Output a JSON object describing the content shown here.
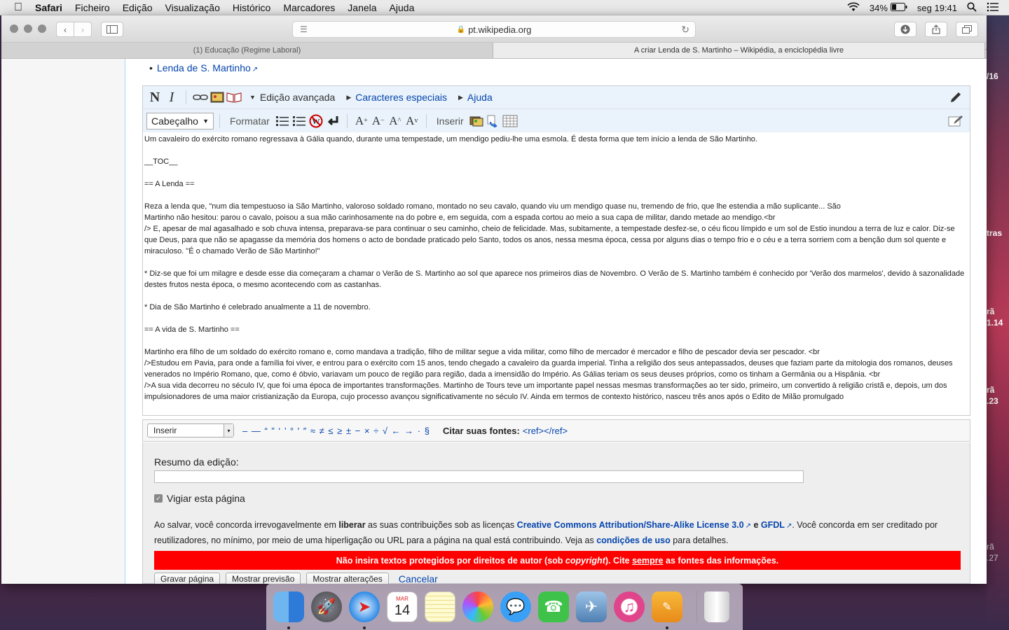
{
  "menubar": {
    "app": "Safari",
    "items": [
      "Ficheiro",
      "Edição",
      "Visualização",
      "Histórico",
      "Marcadores",
      "Janela",
      "Ajuda"
    ],
    "battery": "34%",
    "clock": "seg 19:41"
  },
  "browser": {
    "url": "pt.wikipedia.org",
    "tabs": [
      "(1) Educação (Regime Laboral)",
      "A criar Lenda de S. Martinho – Wikipédia, a enciclopédia livre"
    ],
    "new_tab": "+"
  },
  "desktop_text": [
    "/16",
    "tras",
    "rã",
    "1.14",
    "rã",
    ".23",
    "rã",
    ".27"
  ],
  "page": {
    "bullet_link": "Lenda de S. Martinho"
  },
  "wikitoolbar": {
    "bold": "N",
    "italic": "I",
    "advanced": "Edição avançada",
    "special_chars": "Caracteres especiais",
    "help": "Ajuda",
    "heading_select": "Cabeçalho",
    "format": "Formatar",
    "insert": "Inserir"
  },
  "textarea": {
    "text": "Um cavaleiro do exército romano regressava à Gália quando, durante uma tempestade, um mendigo pediu-lhe uma esmola. É desta forma que tem início a lenda de São Martinho.\n\n__TOC__\n\n== A Lenda ==\n\nReza a lenda que, \"num dia tempestuoso ia São Martinho, valoroso soldado romano, montado no seu cavalo, quando viu um mendigo quase nu, tremendo de frio, que lhe estendia a mão suplicante... São\nMartinho não hesitou: parou o cavalo, poisou a sua mão carinhosamente na do pobre e, em seguida, com a espada cortou ao meio a sua capa de militar, dando metade ao mendigo.<br\n/> E, apesar de mal agasalhado e sob chuva intensa, preparava-se para continuar o seu caminho, cheio de felicidade. Mas, subitamente, a tempestade desfez-se, o céu ficou límpido e um sol de Estio inundou a terra de luz e calor. Diz-se que Deus, para que não se apagasse da memória dos homens o acto de bondade praticado pelo Santo, todos os anos, nessa mesma época, cessa por alguns dias o tempo frio e o céu e a terra sorriem com a benção dum sol quente e miraculoso. \"É o chamado Verão de São Martinho!\"\n\n* Diz-se que foi um milagre e desde esse dia começaram a chamar o Verão de S. Martinho ao sol que aparece nos primeiros dias de Novembro. O Verão de S. Martinho também é conhecido por 'Verão dos marmelos', devido à sazonalidade destes frutos nesta época, o mesmo acontecendo com as castanhas.\n\n* Dia de São Martinho é celebrado anualmente a 11 de novembro.\n\n== A vida de S. Martinho ==\n\nMartinho era filho de um soldado do exército romano e, como mandava a tradição, filho de militar segue a vida militar, como filho de mercador é mercador e filho de pescador devia ser pescador. <br\n/>Estudou em Pavia, para onde a família foi viver, e entrou para o exército com 15 anos, tendo chegado a cavaleiro da guarda imperial. Tinha a religião dos seus antepassados, deuses que faziam parte da mitologia dos romanos, deuses venerados no Império Romano, que, como é óbvio, variavam um pouco de região para região, dada a imensidão do Império. As Gálias teriam os seus deuses próprios, como os tinham a Germânia ou a Hispânia. <br\n/>A sua vida decorreu no século IV, que foi uma época de importantes transformações. Martinho de Tours teve um importante papel nessas mesmas transformações ao ter sido, primeiro, um convertido à religião cristã e, depois, um dos impulsionadores de uma maior cristianização da Europa, cujo processo avançou significativamente no século IV. Ainda em termos de contexto histórico, nasceu três anos após o Edito de Milão promulgado"
  },
  "specialchars": {
    "insert_select": "Inserir",
    "chars": "– — “ ” ‘ ’ ° ′ ″ ≈ ≠ ≤ ≥ ± − × ÷ √ ← → · §",
    "cite_label": "Citar suas fontes:",
    "cite_code": "<ref></ref>"
  },
  "editopts": {
    "summary_label": "Resumo da edição:",
    "summary_value": "",
    "watch_label": "Vigiar esta página",
    "license_1": "Ao salvar, você concorda irrevogavelmente em",
    "license_bold": "liberar",
    "license_2": "as suas contribuições sob as licenças",
    "license_link1": "Creative Commons Attribution/Share-Alike License 3.0",
    "license_e": "e",
    "license_link2": "GFDL",
    "license_3": ". Você concorda em ser creditado por reutilizadores, no mínimo, por meio de uma hiperligação ou URL para a página na qual está contribuindo. Veja as",
    "license_link3": "condições de uso",
    "license_4": "para detalhes.",
    "warn_1": "Não insira textos protegidos por direitos de autor (sob",
    "warn_italic": "copyright",
    "warn_2": "). Cite",
    "warn_u": "sempre",
    "warn_3": "as fontes das informações.",
    "btn_save": "Gravar página",
    "btn_preview": "Mostrar previsão",
    "btn_diff": "Mostrar alterações",
    "cancel": "Cancelar"
  },
  "dock": {
    "calendar_month": "MAR",
    "calendar_day": "14"
  }
}
